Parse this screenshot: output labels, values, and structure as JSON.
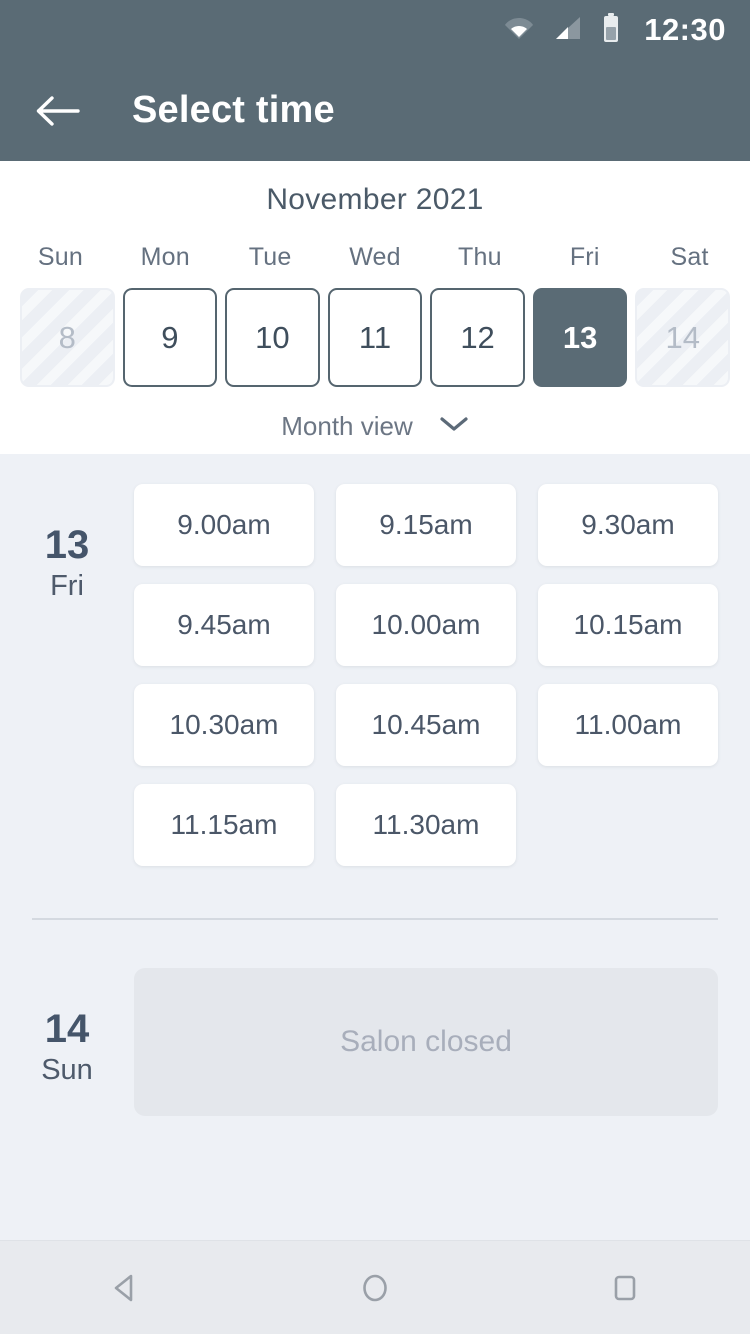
{
  "status_bar": {
    "time": "12:30",
    "icons": [
      "wifi-icon",
      "cellular-signal-icon",
      "battery-icon"
    ]
  },
  "app_bar": {
    "back_icon": "arrow-left-icon",
    "title": "Select time"
  },
  "calendar": {
    "month_label": "November 2021",
    "weekday_headers": [
      "Sun",
      "Mon",
      "Tue",
      "Wed",
      "Thu",
      "Fri",
      "Sat"
    ],
    "days": [
      {
        "number": "8",
        "state": "disabled"
      },
      {
        "number": "9",
        "state": "normal"
      },
      {
        "number": "10",
        "state": "normal"
      },
      {
        "number": "11",
        "state": "normal"
      },
      {
        "number": "12",
        "state": "normal"
      },
      {
        "number": "13",
        "state": "selected"
      },
      {
        "number": "14",
        "state": "disabled"
      }
    ],
    "view_toggle": {
      "label": "Month view",
      "icon": "chevron-down-icon"
    }
  },
  "schedule": {
    "open_day": {
      "day_number": "13",
      "day_name": "Fri",
      "slots": [
        "9.00am",
        "9.15am",
        "9.30am",
        "9.45am",
        "10.00am",
        "10.15am",
        "10.30am",
        "10.45am",
        "11.00am",
        "11.15am",
        "11.30am"
      ]
    },
    "closed_day": {
      "day_number": "14",
      "day_name": "Sun",
      "message": "Salon closed"
    }
  },
  "nav_bar": {
    "buttons": [
      "back-nav-icon",
      "home-nav-icon",
      "recents-nav-icon"
    ]
  },
  "colors": {
    "header": "#5a6b75",
    "page_background": "#eef1f6",
    "card": "#ffffff",
    "text_primary": "#4b5768",
    "text_muted": "#a8aebb",
    "closed_panel": "#e4e7ec"
  }
}
